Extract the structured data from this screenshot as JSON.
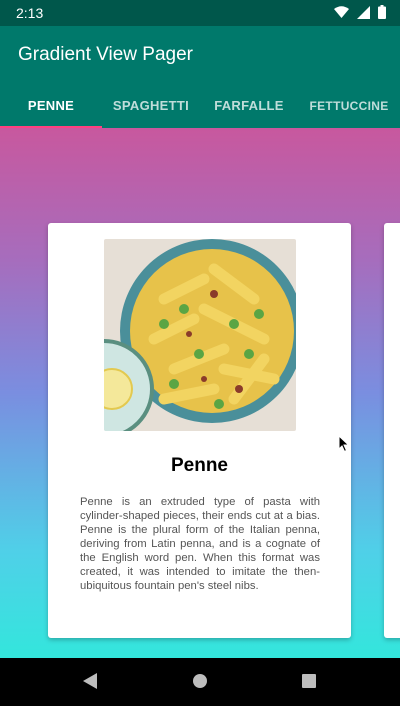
{
  "status_bar": {
    "time": "2:13",
    "icons": [
      "wifi-icon",
      "signal-icon",
      "battery-icon"
    ]
  },
  "app_bar": {
    "title": "Gradient View Pager",
    "background": "#00796b"
  },
  "tabs": [
    {
      "label": "PENNE",
      "active": true
    },
    {
      "label": "SPAGHETTI",
      "active": false
    },
    {
      "label": "FARFALLE",
      "active": false
    },
    {
      "label": "FETTUCCINE",
      "active": false
    }
  ],
  "colors": {
    "status_bar": "#00574b",
    "tab_indicator": "#ff4081",
    "gradient_top": "#c8589e",
    "gradient_bottom": "#33e6dc"
  },
  "card": {
    "image": "penne-pasta-bowl",
    "title": "Penne",
    "description": "Penne is an extruded type of pasta with cylinder-shaped pieces, their ends cut at a bias. Penne is the plural form of the Italian penna, deriving from Latin penna, and is a cognate of the English word pen. When this format was created, it was intended to imitate the then-ubiquitous fountain pen's steel nibs."
  },
  "nav_bar": {
    "buttons": [
      "back-icon",
      "home-icon",
      "recents-icon"
    ]
  }
}
